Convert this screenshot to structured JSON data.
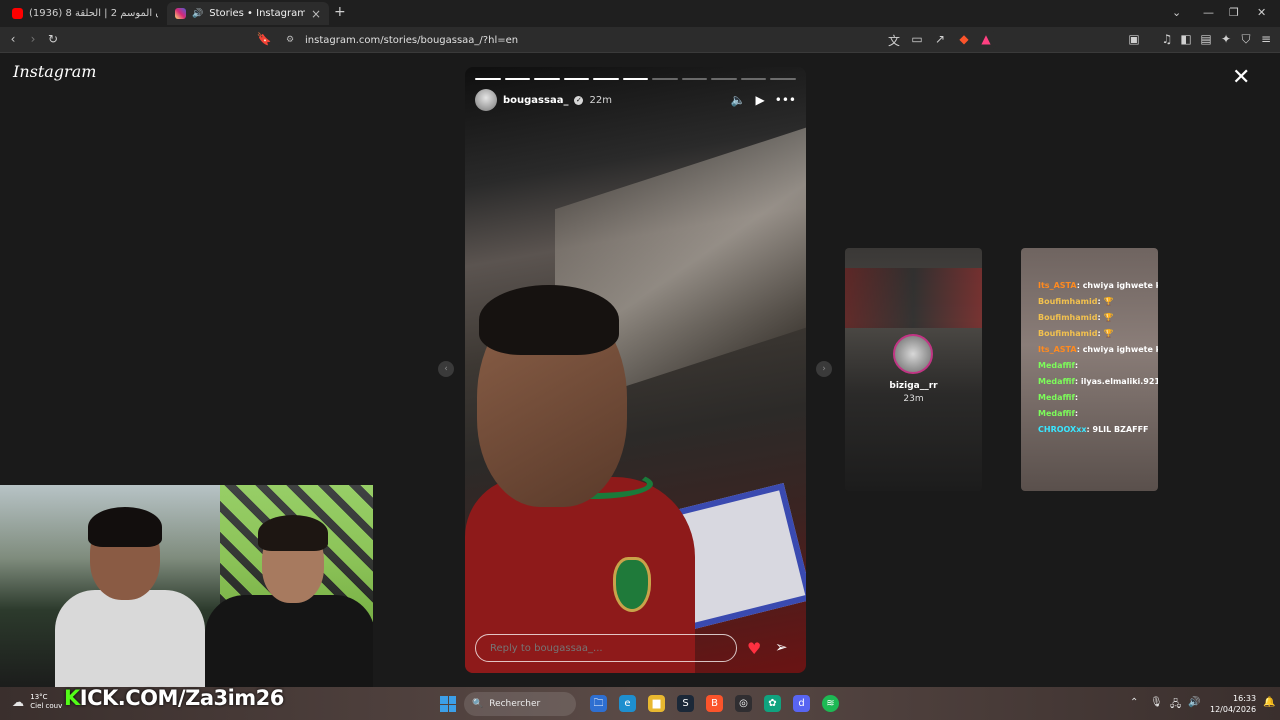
{
  "browser": {
    "tabs": [
      {
        "title": "(1936) دار العرسان الموسم 2 | الحلقة 8",
        "favicon_color": "#ff0000",
        "active": false
      },
      {
        "title": "Stories • Instagram",
        "favicon_color": "#d62976",
        "active": true
      }
    ],
    "new_tab": "+",
    "url": "instagram.com/stories/bougassaa_/?hl=en"
  },
  "instagram": {
    "logo": "Instagram",
    "story": {
      "username": "bougassaa_",
      "time_ago": "22m",
      "segments_total": 11,
      "segments_done": 6,
      "reply_placeholder": "Reply to bougassaa_..."
    },
    "previews": [
      {
        "username": "biziga__rr",
        "time_ago": "23m"
      },
      {
        "chat": [
          {
            "user": "Its_ASTA",
            "msg": ": chwiya ighwete ktar",
            "color": "#ff8a1f"
          },
          {
            "user": "Boufimhamid",
            "msg": ": 🏆",
            "color": "#f2c14e"
          },
          {
            "user": "Boufimhamid",
            "msg": ": 🏆",
            "color": "#f2c14e"
          },
          {
            "user": "Boufimhamid",
            "msg": ": 🏆",
            "color": "#f2c14e"
          },
          {
            "user": "Its_ASTA",
            "msg": ": chwiya ighwete ktar",
            "color": "#ff8a1f"
          },
          {
            "user": "Medaffif",
            "msg": ":",
            "color": "#7cfc5a"
          },
          {
            "user": "Medaffif",
            "msg": ": ilyas.elmaliki.921",
            "color": "#7cfc5a"
          },
          {
            "user": "Medaffif",
            "msg": ":",
            "color": "#7cfc5a"
          },
          {
            "user": "Medaffif",
            "msg": ":",
            "color": "#7cfc5a"
          },
          {
            "user": "CHROOXxx",
            "msg": ": 9LIL BZAFFF",
            "color": "#39e6ff"
          }
        ]
      }
    ]
  },
  "overlay": {
    "kick_text": "KICK.COM/Za3im26",
    "weather_temp": "13°C",
    "weather_desc": "Ciel couv"
  },
  "taskbar": {
    "search_label": "Rechercher",
    "time": "16:33",
    "date": "12/04/2026"
  }
}
